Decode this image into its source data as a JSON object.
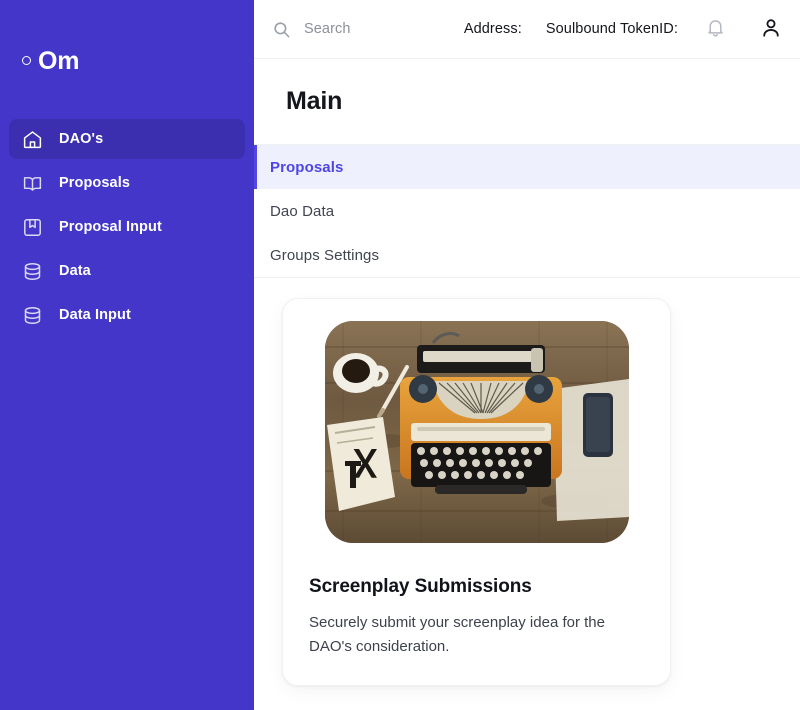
{
  "sidebar": {
    "logo": {
      "mark": "circle-outline-icon",
      "text": "Om"
    },
    "items": [
      {
        "label": "DAO's",
        "icon": "home-icon",
        "active": true
      },
      {
        "label": "Proposals",
        "icon": "open-book-icon",
        "active": false
      },
      {
        "label": "Proposal Input",
        "icon": "bookmark-square-icon",
        "active": false
      },
      {
        "label": "Data",
        "icon": "database-icon",
        "active": false
      },
      {
        "label": "Data Input",
        "icon": "database-icon",
        "active": false
      }
    ]
  },
  "topbar": {
    "search": {
      "icon": "search-icon",
      "placeholder": "Search",
      "value": ""
    },
    "address_label": "Address:",
    "address_value": "",
    "token_label": "Soulbound TokenID:",
    "token_value": "",
    "notifications_icon": "bell-icon",
    "account_icon": "user-icon"
  },
  "page": {
    "title": "Main"
  },
  "tabs": [
    {
      "label": "Proposals",
      "active": true
    },
    {
      "label": "Dao Data",
      "active": false
    },
    {
      "label": "Groups Settings",
      "active": false
    }
  ],
  "card": {
    "image_alt": "vintage orange typewriter on wooden desk with coffee cup, notebook and phone",
    "title": "Screenplay Submissions",
    "description": "Securely submit your screenplay idea for the DAO's consideration."
  },
  "colors": {
    "sidebar_bg": "#4436c8",
    "sidebar_active_bg": "#3b2fb0",
    "accent": "#4f46e5",
    "tab_active_bg": "#eef0fd",
    "text_primary": "#14161c",
    "text_muted": "#8b9099"
  }
}
